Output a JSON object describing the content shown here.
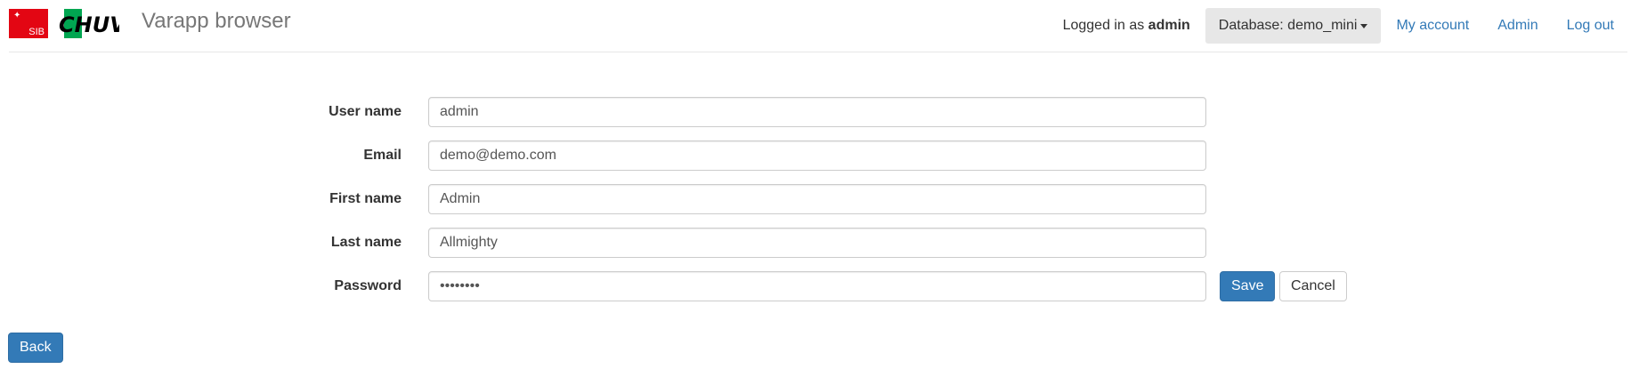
{
  "header": {
    "logo_sib_text": "SIB",
    "logo_chuv_text": "CHUV",
    "brand": "Varapp browser",
    "logged_in_prefix": "Logged in as",
    "logged_in_user": "admin",
    "database_label": "Database: demo_mini",
    "my_account": "My account",
    "admin": "Admin",
    "logout": "Log out"
  },
  "form": {
    "fields": [
      {
        "label": "User name",
        "value": "admin",
        "type": "text"
      },
      {
        "label": "Email",
        "value": "demo@demo.com",
        "type": "text"
      },
      {
        "label": "First name",
        "value": "Admin",
        "type": "text"
      },
      {
        "label": "Last name",
        "value": "Allmighty",
        "type": "text"
      },
      {
        "label": "Password",
        "value": "••••••••",
        "type": "password"
      }
    ],
    "save_label": "Save",
    "cancel_label": "Cancel"
  },
  "back_label": "Back",
  "colors": {
    "primary": "#337ab7",
    "link": "#337ab7",
    "sib_red": "#e30613",
    "chuv_green": "#00a651"
  }
}
